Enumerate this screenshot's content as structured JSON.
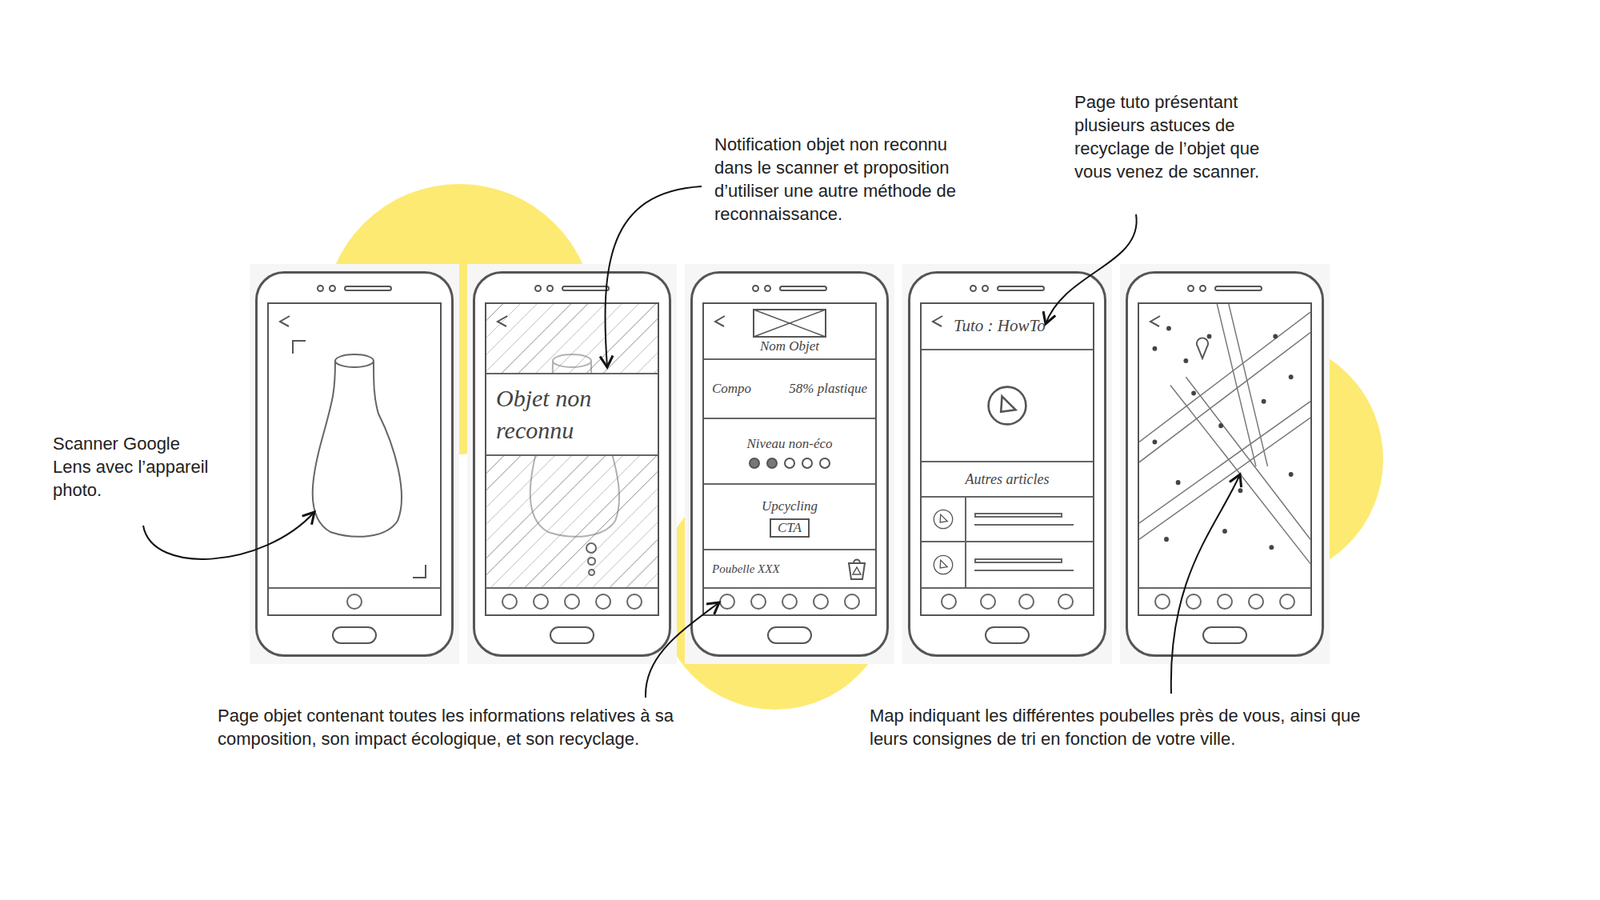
{
  "annotations": [
    {
      "lines": [
        "Scanner Google",
        "Lens avec l’appareil",
        "photo."
      ]
    },
    {
      "lines": [
        "Notification objet non reconnu",
        "dans le scanner et proposition",
        "d’utiliser une autre méthode de",
        "reconnaissance."
      ]
    },
    {
      "lines": [
        "Page tuto présentant",
        "plusieurs astuces de",
        "recyclage de l’objet que",
        "vous venez de scanner."
      ]
    },
    {
      "lines": [
        "Page objet contenant toutes les informations relatives à sa",
        "composition, son impact écologique, et son recyclage."
      ]
    },
    {
      "lines": [
        "Map indiquant les différentes poubelles près de vous, ainsi que",
        "leurs consignes de tri en fonction de votre ville."
      ]
    }
  ],
  "screens": [
    {
      "kind": "scanner",
      "nav_dots": 1
    },
    {
      "kind": "notification",
      "message": "Objet non reconnu",
      "nav_dots": 5
    },
    {
      "kind": "object",
      "title": "Nom Objet",
      "compo_label": "Compo",
      "compo_value": "58% plastique",
      "eco_label": "Niveau non-éco",
      "eco_stars": 2,
      "eco_max": 5,
      "upcycling_label": "Upcycling",
      "cta": "CTA",
      "bin_label": "Poubelle XXX",
      "nav_dots": 5
    },
    {
      "kind": "tuto",
      "title": "Tuto : HowTo",
      "others_label": "Autres articles",
      "articles": 2,
      "nav_dots": 4
    },
    {
      "kind": "map",
      "nav_dots": 5
    }
  ]
}
